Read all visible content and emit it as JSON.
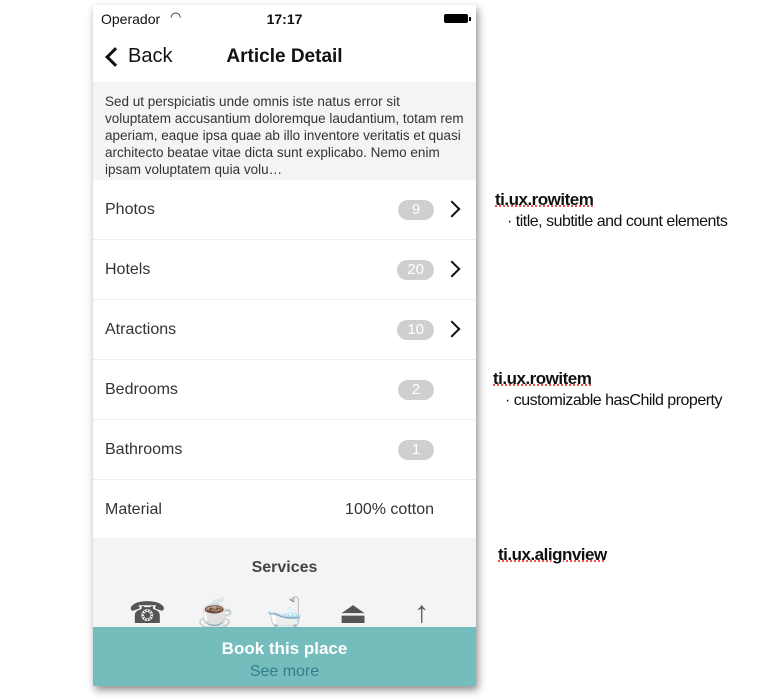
{
  "status_bar": {
    "carrier": "Operador",
    "time": "17:17"
  },
  "nav": {
    "back_label": "Back",
    "title": "Article Detail"
  },
  "description": "Sed ut perspiciatis unde omnis iste natus error sit voluptatem accusantium doloremque laudantium, totam rem aperiam, eaque ipsa quae ab illo inventore veritatis et quasi architecto beatae vitae dicta sunt explicabo. Nemo enim ipsam voluptatem quia volu…",
  "rows": [
    {
      "title": "Photos",
      "count": "9",
      "has_child": true
    },
    {
      "title": "Hotels",
      "count": "20",
      "has_child": true
    },
    {
      "title": "Atractions",
      "count": "10",
      "has_child": true
    },
    {
      "title": "Bedrooms",
      "count": "2",
      "has_child": false
    },
    {
      "title": "Bathrooms",
      "count": "1",
      "has_child": false
    },
    {
      "title": "Material",
      "value": "100% cotton",
      "has_child": false
    }
  ],
  "services": {
    "title": "Services",
    "icons": [
      "phone-icon",
      "mug-icon",
      "bathtub-icon",
      "lamp-icon",
      "rocket-icon"
    ],
    "see_more": "See more"
  },
  "book_button": "Book this place",
  "accent_color": "#74bcbd",
  "annotations": [
    {
      "title": "ti.ux.rowitem",
      "subtitle": "· title, subtitle and count elements"
    },
    {
      "title": "ti.ux.rowitem",
      "subtitle": "· customizable hasChild property"
    },
    {
      "title": "ti.ux.alignview"
    }
  ]
}
